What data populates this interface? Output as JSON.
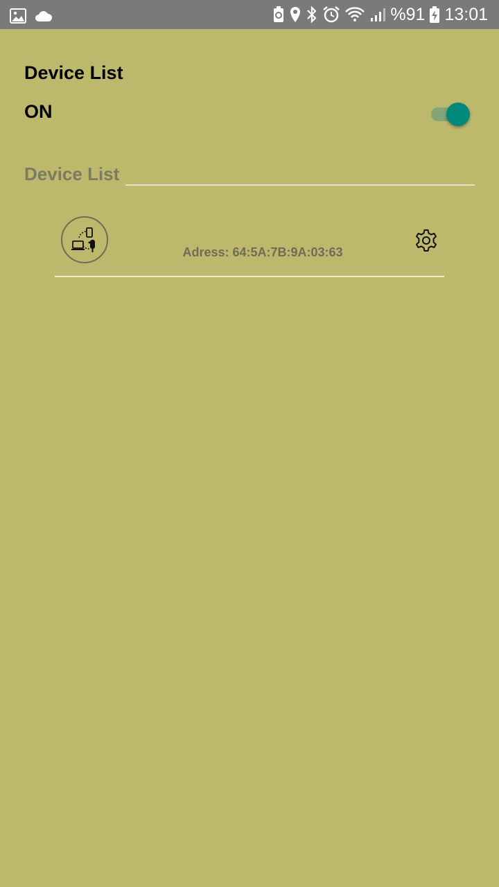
{
  "status_bar": {
    "icons_left": [
      "gallery-icon",
      "cloud-icon"
    ],
    "icons_right": [
      "battery-saver-icon",
      "location-icon",
      "bluetooth-icon",
      "alarm-icon",
      "wifi-icon",
      "signal-icon"
    ],
    "battery_percent": "%91",
    "time": "13:01"
  },
  "header": {
    "title": "Device List",
    "toggle_label": "ON",
    "toggle_on": true
  },
  "section": {
    "label": "Device List"
  },
  "devices": [
    {
      "icon": "device-connection-icon",
      "address": "Adress: 64:5A:7B:9A:03:63",
      "settings_icon": "gear-icon"
    }
  ],
  "colors": {
    "background": "#bdb96c",
    "status_bar": "#7a7a7a",
    "accent": "#00897b"
  }
}
